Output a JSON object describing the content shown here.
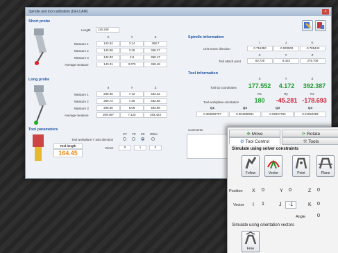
{
  "window": {
    "title": "Spindle and tool calibration [DELCAM]",
    "close_label": "×"
  },
  "short_probe": {
    "title": "Short probe",
    "length_label": "Length",
    "length_value": "116.248",
    "col_x": "X",
    "col_y": "Y",
    "col_z": "Z",
    "rows": [
      {
        "label": "Measure 1",
        "x": "143.52",
        "y": "3.14",
        "z": "368.7"
      },
      {
        "label": "Measure 2",
        "x": "143.58",
        "y": "3.26",
        "z": "368.27"
      },
      {
        "label": "Measure 3",
        "x": "142.83",
        "y": "2.8",
        "z": "368.47"
      },
      {
        "label": "Average measure",
        "x": "143.31",
        "y": "3.073",
        "z": "368.48"
      }
    ]
  },
  "long_probe": {
    "title": "Long probe",
    "col_x": "X",
    "col_y": "Y",
    "col_z": "Z",
    "rows": [
      {
        "label": "Measure 1",
        "x": "209.30",
        "y": "7.12",
        "z": "483.32"
      },
      {
        "label": "Measure 2",
        "x": "209.72",
        "y": "7.36",
        "z": "482.99"
      },
      {
        "label": "Measure 3",
        "x": "209.30",
        "y": "6.09",
        "z": "483.96"
      },
      {
        "label": "Average measure",
        "x": "209.457",
        "y": "7.123",
        "z": "483.423"
      }
    ]
  },
  "spindle_info": {
    "title": "Spindle information",
    "col_i": "I",
    "col_j": "J",
    "col_k": "K",
    "unit_vector_label": "Unit vector direction",
    "unit_vector": [
      "0.716350",
      "-0.020502",
      "-0.785443"
    ],
    "col_x": "X",
    "col_y": "Y",
    "col_z": "Z",
    "attach_label": "Tool attach point",
    "attach": [
      "60.729",
      "8.423",
      "276.706"
    ]
  },
  "tool_info": {
    "title": "Tool information",
    "col_x": "X",
    "col_y": "Y",
    "col_z": "Z",
    "coords_label": "Tool tip coordinates",
    "coords": [
      "177.552",
      "4.172",
      "392.387"
    ],
    "col_rx": "Rx",
    "col_ry": "Ry",
    "col_rz": "Rz",
    "orient_label": "Tool workplane orientation",
    "orient": [
      "180",
      "-45.281",
      "-178.693"
    ],
    "q_headers": [
      "Q1",
      "Q2",
      "Q3",
      "Q4"
    ],
    "q_values": [
      "0.384902707",
      "0.004389091",
      "0.92267702",
      "0.01052383"
    ],
    "colors": {
      "green": "#1f9d2f",
      "red": "#d0203a"
    }
  },
  "tool_params": {
    "title": "Tool parameters",
    "axis_label": "Tool workplane Y axis direction",
    "options": [
      "XY",
      "YZ",
      "ZX",
      "Other"
    ],
    "selected": "ZX",
    "tool_length_label": "Tool length",
    "tool_length_value": "164.45",
    "vector_label": "Vector",
    "vector": [
      "0",
      "1",
      "0"
    ]
  },
  "comments": {
    "label": "Comments"
  },
  "tool_panel": {
    "tabs_top": [
      "Move",
      "Rotate"
    ],
    "tabs_bottom": [
      "Tool Control",
      "Tools"
    ],
    "solver_title": "Simulate using solver constraints",
    "buttons": [
      "Follow",
      "Vector",
      "Point",
      "Plane"
    ],
    "position_label": "Position",
    "position": {
      "x_label": "X",
      "x": "0",
      "y_label": "Y",
      "y": "0",
      "z_label": "Z",
      "z": "0"
    },
    "vector_label": "Vector",
    "vector": {
      "i_label": "I",
      "i": "1",
      "j_label": "J",
      "j": "-1",
      "k_label": "K",
      "k": "0"
    },
    "angle_label": "Angle",
    "angle": "0",
    "orient_title": "Simulate using orientation vectors",
    "free_label": "Free"
  }
}
